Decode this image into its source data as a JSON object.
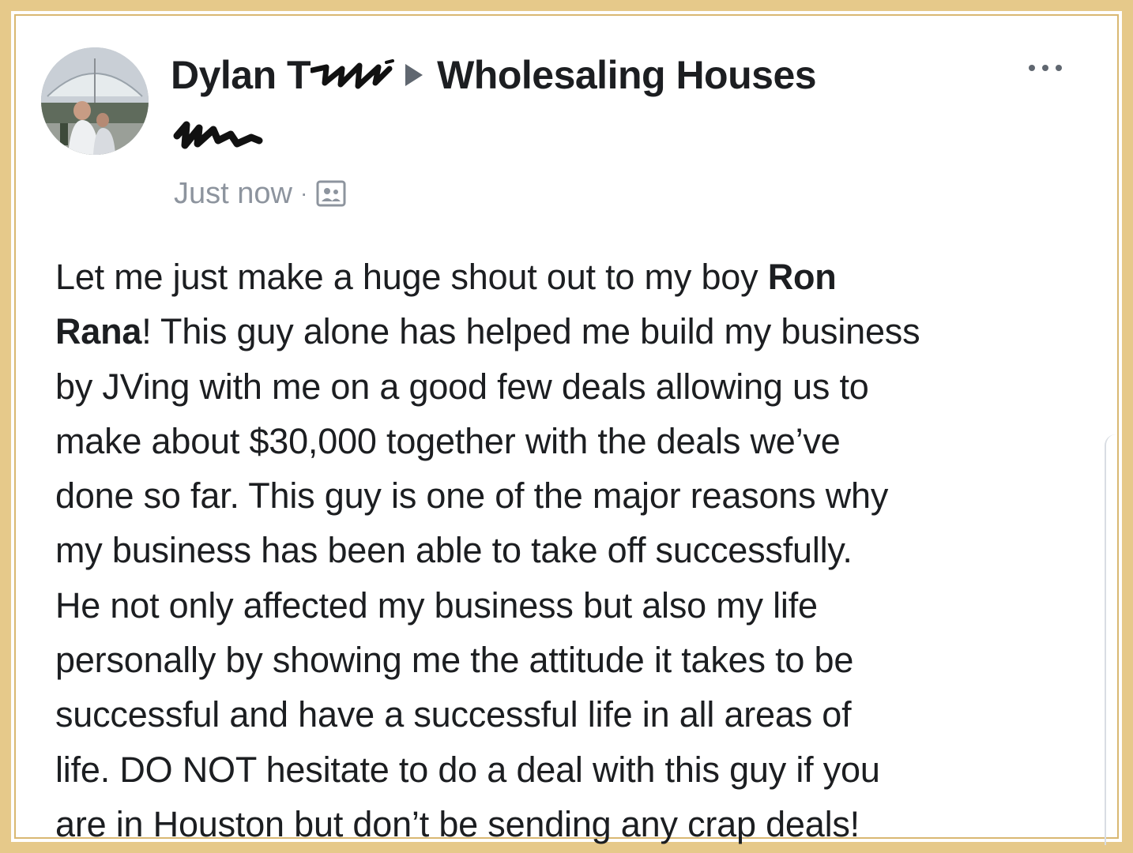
{
  "post": {
    "author": "Dylan T",
    "group": "Wholesaling Houses",
    "timestamp": "Just now",
    "separator": "·",
    "audience_icon": "group-members-icon",
    "more_icon": "more-options-icon",
    "body": {
      "line1": "Let me just make a huge shout out to my boy ",
      "mention_part1": "Ron",
      "mention_part2": "Rana",
      "line2_rest": "! This guy alone has helped me build my business",
      "line3": "by JVing with me on a good few deals allowing us to",
      "line4": "make about $30,000 together with the deals we’ve",
      "line5": "done so far. This guy is one of the major reasons why",
      "line6": "my business has been able to take off successfully.",
      "line7": "He not only affected my business but also my life",
      "line8": "personally by showing me the attitude it takes to be",
      "line9": "successful and have a successful life in all areas of",
      "line10": "life. DO NOT hesitate to do a deal with this guy if you",
      "line11": "are in Houston but don’t be sending any crap deals!"
    }
  },
  "colors": {
    "frame": "#e6c98a",
    "text": "#1c1e21",
    "meta": "#8d949e",
    "arrow": "#606770"
  }
}
